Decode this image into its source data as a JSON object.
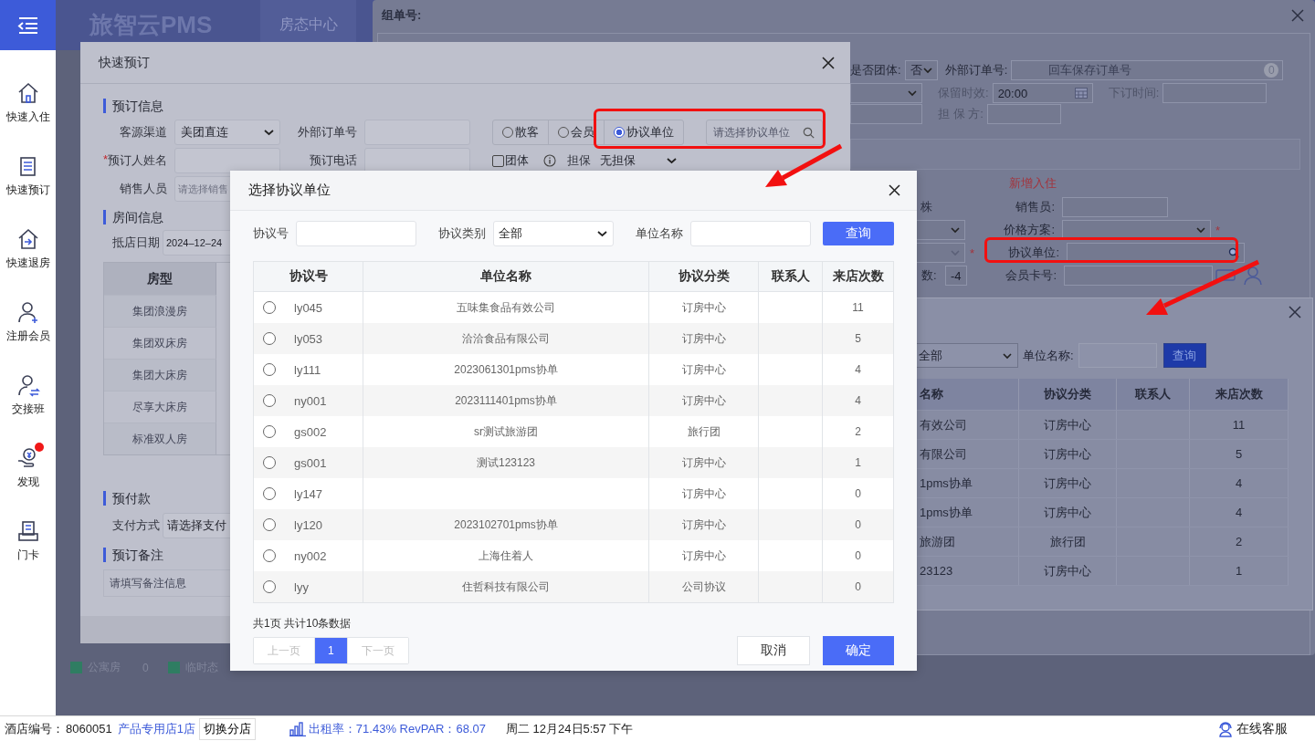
{
  "sidebar": {
    "items": [
      {
        "label": "快速入住",
        "alert": false
      },
      {
        "label": "快速预订",
        "alert": false
      },
      {
        "label": "快速退房",
        "alert": false
      },
      {
        "label": "注册会员",
        "alert": false
      },
      {
        "label": "交接班",
        "alert": false
      },
      {
        "label": "发现",
        "alert": true
      },
      {
        "label": "门卡",
        "alert": false
      }
    ]
  },
  "header": {
    "logo": "旅智云PMS",
    "tab": "房态中心"
  },
  "legend": [
    {
      "label": "公寓房",
      "count": "0"
    },
    {
      "label": "临时态"
    }
  ],
  "status_bar": {
    "hotel_label": "酒店编号：",
    "hotel_id": "8060051",
    "store": "产品专用店1店",
    "switch_button": "切换分店",
    "occupancy": "出租率：71.43% RevPAR：68.07",
    "datetime": "周二 12月24日5:57 下午",
    "support": "在线客服"
  },
  "order_dialog": {
    "title": "组单号:",
    "group_label": "是否团体:",
    "group_value": "否",
    "external_label": "外部订单号:",
    "external_placeholder": "回车保存订单号",
    "external_badge": "0",
    "hold_label": "保留时效:",
    "hold_value": "20:00",
    "order_time_label": "下订时间:",
    "guarantor_label": "担 保 方:",
    "section_title": "新增入住",
    "fragment": "株",
    "sales_label": "销售员:",
    "price_plan_label": "价格方案:",
    "price_required": "*",
    "room_required": "*",
    "agreement_label": "协议单位:",
    "nights_label": "数:",
    "nights_value": "-4",
    "member_label": "会员卡号:"
  },
  "agreement_list_dialog": {
    "category": "全部",
    "name_label": "单位名称:",
    "query_button": "查询",
    "columns": [
      "名称",
      "协议分类",
      "联系人",
      "来店次数"
    ],
    "rows": [
      {
        "name": "有效公司",
        "category": "订房中心",
        "count": "11"
      },
      {
        "name": "有限公司",
        "category": "订房中心",
        "count": "5"
      },
      {
        "name": "1pms协单",
        "category": "订房中心",
        "count": "4"
      },
      {
        "name": "1pms协单",
        "category": "订房中心",
        "count": "4"
      },
      {
        "name": "旅游团",
        "category": "旅行团",
        "count": "2"
      },
      {
        "name": "23123",
        "category": "订房中心",
        "count": "1"
      }
    ]
  },
  "quick_booking": {
    "title": "快速预订",
    "booking_section": "预订信息",
    "source_label": "客源渠道",
    "source_value": "美团直连",
    "external_label": "外部订单号",
    "guest_types": [
      {
        "label": "散客",
        "selected": false
      },
      {
        "label": "会员",
        "selected": false
      },
      {
        "label": "协议单位",
        "selected": true
      }
    ],
    "agreement_placeholder": "请选择协议单位",
    "required_mark": "*",
    "booker_label": "预订人姓名",
    "phone_label": "预订电话",
    "group_label": "团体",
    "group_checked": false,
    "guarantee_label": "担保",
    "guarantee_value": "无担保",
    "sales_label": "销售人员",
    "sales_placeholder": "请选择销售",
    "room_section": "房间信息",
    "arrival_label": "抵店日期",
    "arrival_value": "2024–12–24",
    "room_table": {
      "column": "房型",
      "rows": [
        "集团浪漫房",
        "集团双床房",
        "集团大床房",
        "尽享大床房",
        "标准双人房"
      ]
    },
    "prepay_section": "预付款",
    "payment_label": "支付方式",
    "payment_placeholder": "请选择支付",
    "remark_section": "预订备注",
    "remark_placeholder": "请填写备注信息"
  },
  "select_dialog": {
    "title": "选择协议单位",
    "code_label": "协议号",
    "category_label": "协议类别",
    "category_value": "全部",
    "name_label": "单位名称",
    "query_button": "查询",
    "columns": [
      "协议号",
      "单位名称",
      "协议分类",
      "联系人",
      "来店次数"
    ],
    "rows": [
      {
        "selected": false,
        "code": "ly045",
        "name": "五味集食品有效公司",
        "category": "订房中心",
        "count": "11"
      },
      {
        "selected": false,
        "code": "ly053",
        "name": "洽洽食品有限公司",
        "category": "订房中心",
        "count": "5"
      },
      {
        "selected": false,
        "code": "ly111",
        "name": "2023061301pms协单",
        "category": "订房中心",
        "count": "4"
      },
      {
        "selected": false,
        "code": "ny001",
        "name": "2023111401pms协单",
        "category": "订房中心",
        "count": "4"
      },
      {
        "selected": false,
        "code": "gs002",
        "name": "sr测试旅游团",
        "category": "旅行团",
        "count": "2"
      },
      {
        "selected": false,
        "code": "gs001",
        "name": "测试123123",
        "category": "订房中心",
        "count": "1"
      },
      {
        "selected": false,
        "code": "ly147",
        "category": "订房中心",
        "count": "0"
      },
      {
        "selected": false,
        "code": "ly120",
        "name": "2023102701pms协单",
        "category": "订房中心",
        "count": "0"
      },
      {
        "selected": false,
        "code": "ny002",
        "name": "上海住着人",
        "category": "订房中心",
        "count": "0"
      },
      {
        "selected": false,
        "code": "lyy",
        "name": "住哲科技有限公司",
        "category": "公司协议",
        "count": "0"
      }
    ],
    "summary": "共1页 共计10条数据",
    "pager": [
      {
        "label": "上一页",
        "selected": false,
        "disabled": true
      },
      {
        "label": "1",
        "selected": true,
        "disabled": false
      },
      {
        "label": "下一页",
        "selected": false,
        "disabled": true
      }
    ],
    "cancel_button": "取消",
    "confirm_button": "确定"
  }
}
